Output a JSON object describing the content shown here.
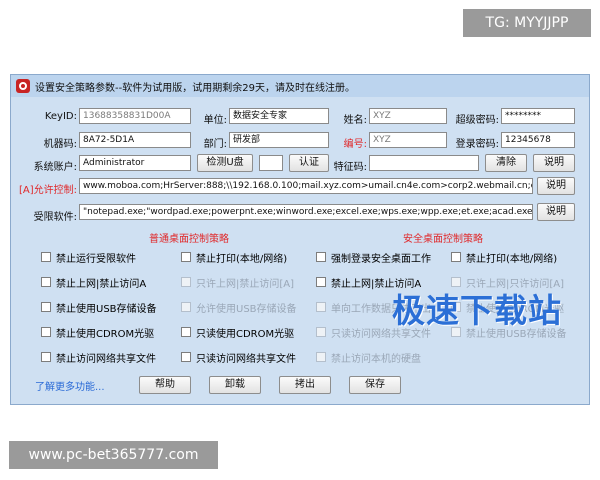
{
  "watermarks": {
    "tg": "TG: MYYJJPP",
    "site": "www.pc-bet365777.com"
  },
  "window": {
    "title": "设置安全策略参数--软件为试用版，试用期剩余29天，请及时在线注册。"
  },
  "form": {
    "keyid_label": "KeyID:",
    "keyid_value": "13688358831D00A",
    "unit_label": "单位:",
    "unit_value": "数据安全专家",
    "name_label": "姓名:",
    "name_value": "XYZ",
    "superpw_label": "超级密码:",
    "superpw_value": "********",
    "machine_label": "机器码:",
    "machine_value": "8A72-5D1A",
    "dept_label": "部门:",
    "dept_value": "研发部",
    "number_label": "编号:",
    "number_value": "XYZ",
    "loginpw_label": "登录密码:",
    "loginpw_value": "12345678",
    "account_label": "系统账户:",
    "account_value": "Administrator",
    "detect_usb_button": "检测U盘",
    "auth_button": "认证",
    "feature_label": "特征码:",
    "feature_value": "",
    "clear_button": "清除",
    "help_button_1": "说明",
    "allow_label": "[A]允许控制:",
    "allow_value": "www.moboa.com;HrServer:888;\\\\192.168.0.100;mail.xyz.com>umail.cn4e.com>corp2.webmail.cn;erp.scimee.com:5",
    "help_button_2": "说明",
    "limit_label": "受限软件:",
    "limit_value": "\"notepad.exe;\"wordpad.exe;powerpnt.exe;winword.exe;excel.exe;wps.exe;wpp.exe;et.exe;acad.exe;bricscad.exe;zwc",
    "help_button_3": "说明"
  },
  "normal_policy": {
    "title": "普通桌面控制策略",
    "left": [
      "禁止运行受限软件",
      "禁止上网|禁止访问A",
      "禁止使用USB存储设备",
      "禁止使用CDROM光驱",
      "禁止访问网络共享文件"
    ],
    "right": [
      "禁止打印(本地/网络)",
      "只许上网|禁止访问[A]",
      "允许使用USB存储设备",
      "只读使用CDROM光驱",
      "只读访问网络共享文件"
    ]
  },
  "secure_policy": {
    "title": "安全桌面控制策略",
    "left": [
      "强制登录安全桌面工作",
      "禁止上网|禁止访问A",
      "单向工作数据只进不出",
      "只读访问网络共享文件",
      "禁止访问本机的硬盘"
    ],
    "right": [
      "禁止打印(本地/网络)",
      "只许上网|只许访问[A]",
      "禁止使用CDROM光驱",
      "禁止使用USB存储设备",
      ""
    ]
  },
  "footer": {
    "more_link": "了解更多功能...",
    "help": "帮助",
    "uninstall": "卸载",
    "logout": "拷出",
    "save": "保存"
  },
  "logo_text": "极速下载站",
  "colors": {
    "window_bg": "#cfe0f2",
    "titlebar": "#bcd4ee",
    "section_red": "#e0282a",
    "logo_blue": "#2b6fd6"
  }
}
